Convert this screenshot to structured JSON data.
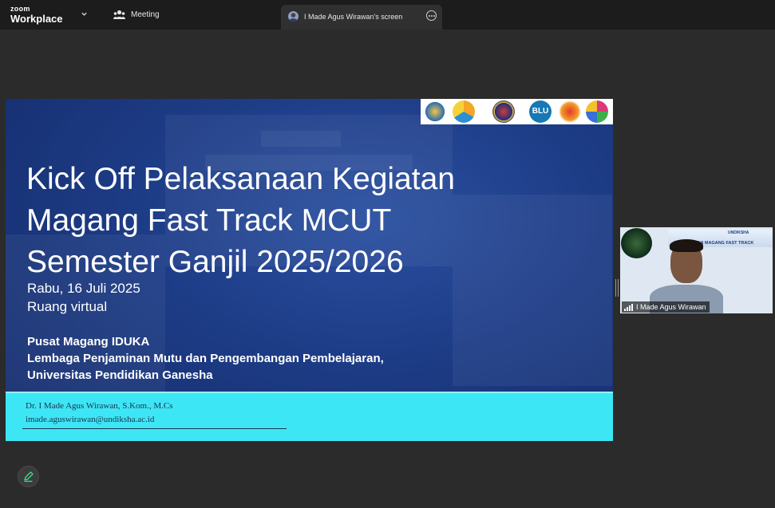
{
  "app": {
    "brand_line1": "zoom",
    "brand_line2": "Workplace"
  },
  "header": {
    "meeting_label": "Meeting",
    "share_tab_label": "I Made Agus Wirawan's screen"
  },
  "slide": {
    "title_lines": [
      "Kick Off Pelaksanaan Kegiatan",
      "Magang Fast Track MCUT",
      "Semester Ganjil 2025/2026"
    ],
    "date": "Rabu, 16 Juli 2025",
    "venue": "Ruang virtual",
    "org_lines": [
      "Pusat Magang IDUKA",
      "Lembaga Penjaminan Mutu dan Pengembangan Pembelajaran,",
      "Universitas Pendidikan Ganesha"
    ],
    "presenter_name": "Dr. I Made Agus Wirawan, S.Kom., M.Cs",
    "presenter_email": "imade.aguswirawan@undiksha.ac.id",
    "logo_badge": "BLU"
  },
  "video": {
    "participant_name": "I Made Agus Wirawan",
    "banner_text": "PENJAMINAN MAGANG FAST TRACK",
    "banner_brand": "UNDIKSHA"
  },
  "icons": {
    "zoom": "zoom-logo",
    "chevron": "chevron-down-icon",
    "meeting": "participants-icon",
    "more": "more-options-icon",
    "signal": "signal-bars-icon",
    "annotate": "pencil-icon"
  },
  "colors": {
    "accent_band": "#3de6f5",
    "slide_bg": "#1d3c86",
    "app_bg": "#2b2b2b"
  }
}
